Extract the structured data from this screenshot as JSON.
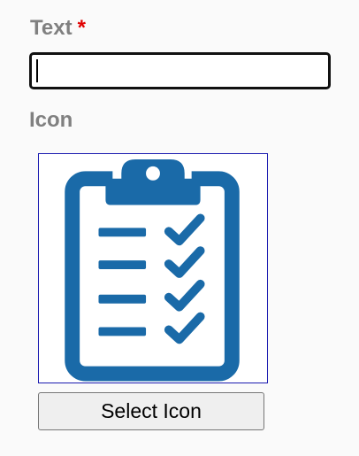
{
  "form": {
    "text_label": "Text",
    "required_marker": "*",
    "text_value": "",
    "icon_label": "Icon",
    "icon_name": "clipboard-checklist-icon",
    "select_button_label": "Select Icon"
  },
  "colors": {
    "label": "#808080",
    "required": "#e00000",
    "icon_blue": "#1a6aa8",
    "preview_border": "#1b1bb0"
  }
}
